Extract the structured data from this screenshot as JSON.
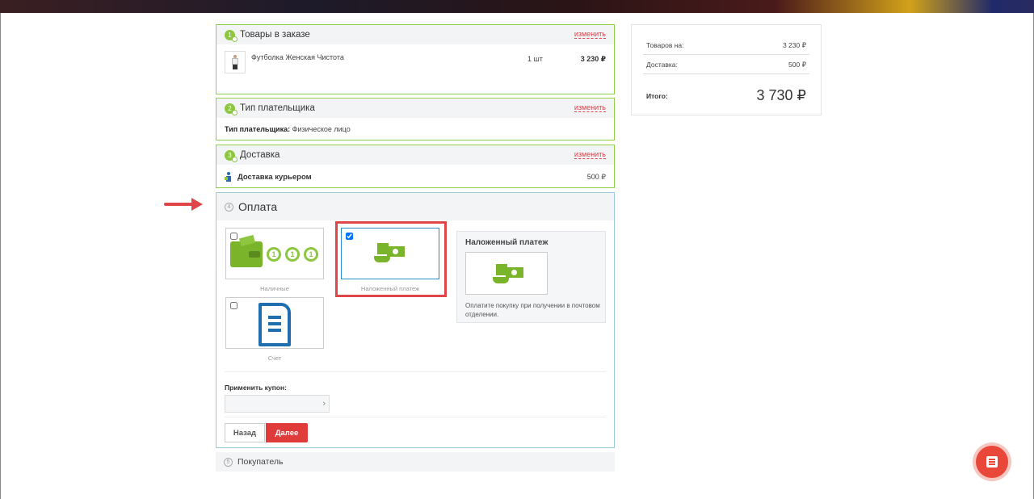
{
  "order_items": {
    "title": "Товары в заказе",
    "step": "1",
    "change": "изменить",
    "item": {
      "name": "Футболка Женская Чистота",
      "qty": "1 шт",
      "price": "3 230 ₽"
    }
  },
  "payer_type": {
    "title": "Тип плательщика",
    "step": "2",
    "change": "изменить",
    "label": "Тип плательщика:",
    "value": "Физическое лицо"
  },
  "delivery": {
    "title": "Доставка",
    "step": "3",
    "change": "изменить",
    "method": "Доставка курьером",
    "price": "500 ₽"
  },
  "payment": {
    "title": "Оплата",
    "step": "4",
    "options": [
      {
        "label": "Наличные",
        "icon": "wallet-coins-icon",
        "checked": false
      },
      {
        "label": "Наложенный платеж",
        "icon": "cash-on-delivery-icon",
        "checked": true
      },
      {
        "label": "Счет",
        "icon": "document-icon",
        "checked": false
      }
    ],
    "selected_info": {
      "title": "Наложенный платеж",
      "description": "Оплатите покупку при получении в почтовом отделении."
    },
    "coupon_label": "Применить купон:",
    "back_button": "Назад",
    "next_button": "Далее"
  },
  "buyer": {
    "title": "Покупатель",
    "step": "5"
  },
  "summary": {
    "goods_label": "Товаров на:",
    "goods_value": "3 230 ₽",
    "delivery_label": "Доставка:",
    "delivery_value": "500 ₽",
    "total_label": "Итого:",
    "total_value": "3 730 ₽"
  },
  "colors": {
    "accent_green": "#8dc63f",
    "accent_red": "#e03b3b",
    "selected_blue": "#2a8bc9"
  }
}
